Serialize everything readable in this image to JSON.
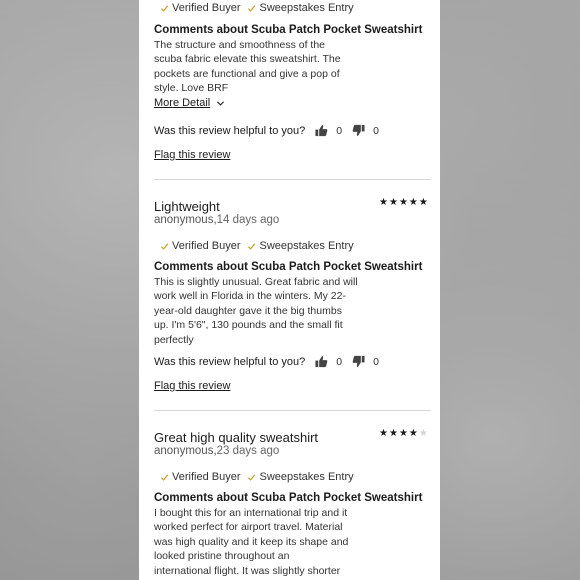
{
  "labels": {
    "verified": "Verified Buyer",
    "sweepstakes": "Sweepstakes Entry",
    "more_detail": "More Detail",
    "helpful_question": "Was this review helpful to you?",
    "flag": "Flag this review"
  },
  "reviews": [
    {
      "comments_heading": "Comments about Scuba Patch Pocket Sweatshirt",
      "body_lines": [
        "The structure and smoothness of the",
        "scuba fabric elevate this sweatshirt. The",
        "pockets are functional and give a pop of",
        "style. Love BRF"
      ],
      "helpful_up": "0",
      "helpful_down": "0"
    },
    {
      "title": "Lightweight",
      "author": "anonymous,",
      "date": "14 days ago",
      "rating": 5,
      "rating_max": 5,
      "comments_heading": "Comments about Scuba Patch Pocket Sweatshirt",
      "body_lines": [
        "This is slightly unusual. Great fabric and will",
        "work well in Florida in the winters. My 22-",
        "year-old daughter gave it the big thumbs",
        "up. I'm 5'6\", 130 pounds and the small fit",
        "perfectly"
      ],
      "helpful_up": "0",
      "helpful_down": "0"
    },
    {
      "title": "Great high quality sweatshirt",
      "author": "anonymous,",
      "date": "23 days ago",
      "rating": 4,
      "rating_max": 5,
      "comments_heading": "Comments about Scuba Patch Pocket Sweatshirt",
      "body_lines": [
        "I bought this for an international trip and it",
        "worked perfect for airport travel. Material",
        "was high quality and it keep its shape and",
        "looked pristine throughout an",
        "international flight. It was slightly shorter"
      ]
    }
  ],
  "colors": {
    "text": "#1b1b1b",
    "muted": "#666666",
    "divider": "#d8d8d8",
    "check": "#c9a227"
  }
}
